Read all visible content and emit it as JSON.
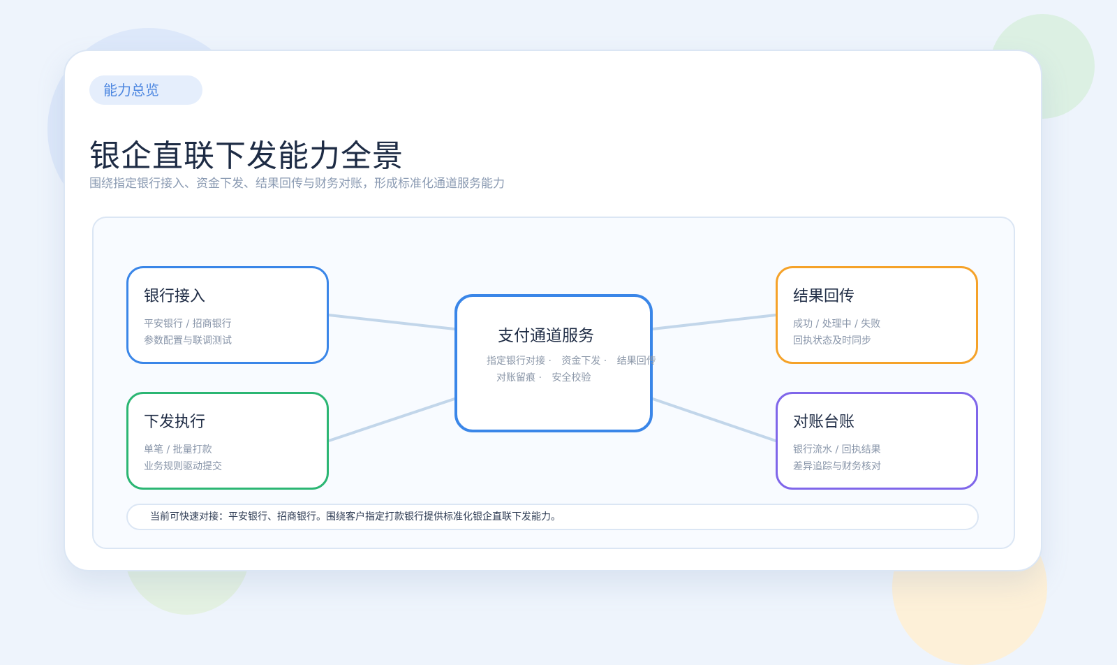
{
  "badge": "能力总览",
  "title": "银企直联下发能力全景",
  "subtitle": "围绕指定银行接入、资金下发、结果回传与财务对账，形成标准化通道服务能力",
  "hub": {
    "title": "支付通道服务",
    "tags": [
      "指定银行对接 ·",
      "资金下发 ·",
      "结果回传",
      "对账留痕 ·",
      "安全校验"
    ]
  },
  "nodes": {
    "bank": {
      "title": "银行接入",
      "line1": "平安银行 / 招商银行",
      "line2": "参数配置与联调测试",
      "color": "#3a86e8"
    },
    "exec": {
      "title": "下发执行",
      "line1": "单笔 / 批量打款",
      "line2": "业务规则驱动提交",
      "color": "#2bb673"
    },
    "result": {
      "title": "结果回传",
      "line1": "成功 / 处理中 / 失败",
      "line2": "回执状态及时同步",
      "color": "#f5a229"
    },
    "recon": {
      "title": "对账台账",
      "line1": "银行流水 / 回执结果",
      "line2": "差异追踪与财务核对",
      "color": "#7f66ea"
    }
  },
  "note": "当前可快速对接：平安银行、招商银行。围绕客户指定打款银行提供标准化银企直联下发能力。"
}
